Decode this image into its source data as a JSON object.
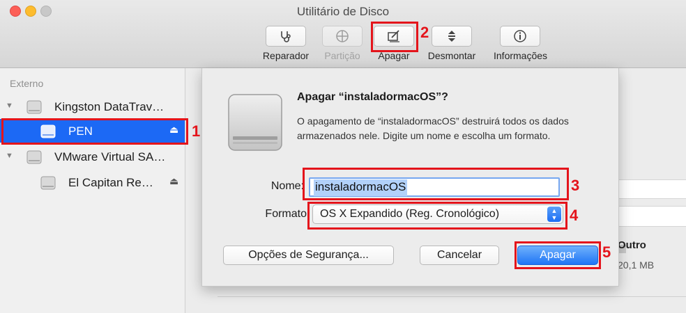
{
  "window": {
    "title": "Utilitário de Disco"
  },
  "toolbar": {
    "items": [
      {
        "label": "Reparador",
        "icon": "stethoscope-icon",
        "enabled": true
      },
      {
        "label": "Partição",
        "icon": "partition-icon",
        "enabled": false
      },
      {
        "label": "Apagar",
        "icon": "erase-icon",
        "enabled": true
      },
      {
        "label": "Desmontar",
        "icon": "unmount-icon",
        "enabled": true
      },
      {
        "label": "Informações",
        "icon": "info-icon",
        "enabled": true
      }
    ]
  },
  "sidebar": {
    "section": "Externo",
    "items": [
      {
        "label": "Kingston DataTrav…"
      },
      {
        "label": "PEN",
        "selected": true
      },
      {
        "label": "VMware Virtual SA…"
      },
      {
        "label": "El Capitan Re…"
      }
    ]
  },
  "background": {
    "other_label": "Outro",
    "other_size": "20,1 MB"
  },
  "sheet": {
    "title": "Apagar “instaladormacOS”?",
    "description": "O apagamento de “instaladormacOS” destruirá todos os dados armazenados nele. Digite um nome e escolha um formato.",
    "name_label": "Nome:",
    "name_value": "instaladormacOS",
    "format_label": "Formato",
    "format_value": "OS X Expandido (Reg. Cronológico)",
    "security_button": "Opções de Segurança...",
    "cancel_button": "Cancelar",
    "erase_button": "Apagar"
  },
  "annotations": {
    "step1": "1",
    "step2": "2",
    "step3": "3",
    "step4": "4",
    "step5": "5",
    "color": "#e4141b"
  },
  "colors": {
    "selection": "#1c69f5",
    "primary_button": "#1f75f5"
  }
}
